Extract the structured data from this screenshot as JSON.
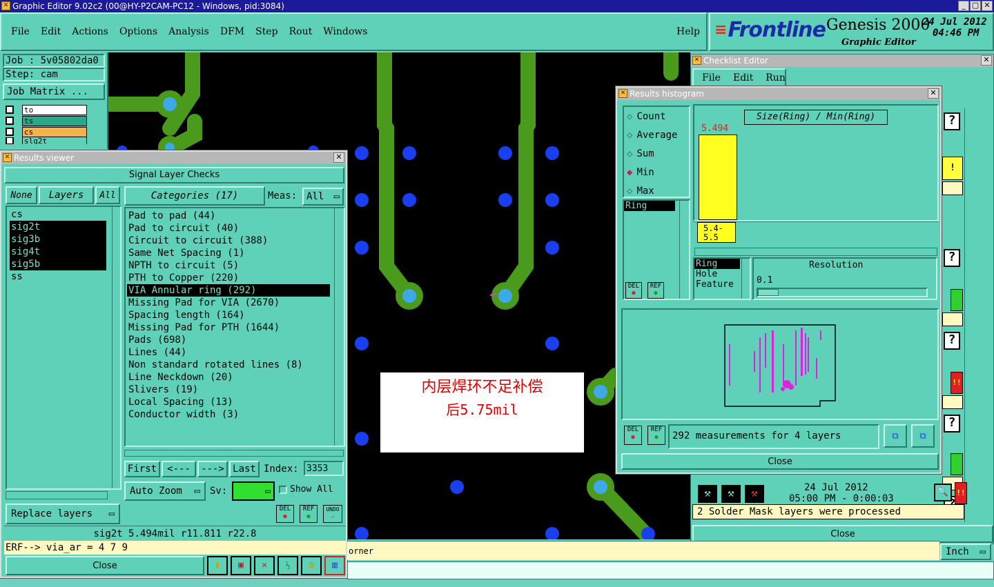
{
  "app": {
    "title": "Graphic Editor 9.02c2 (00@HY-P2CAM-PC12 - Windows, pid:3084)",
    "menu": [
      "File",
      "Edit",
      "Actions",
      "Options",
      "Analysis",
      "DFM",
      "Step",
      "Rout",
      "Windows"
    ],
    "help": "Help",
    "brand": "Frontline",
    "product": "Genesis 2000",
    "subtitle": "Graphic Editor",
    "date": "24 Jul 2012",
    "time": "04:46 PM"
  },
  "job": {
    "job_label": "Job  : 5v05802da0",
    "step_label": "Step: cam",
    "matrix_button": "Job Matrix ...",
    "layers": [
      {
        "name": "to",
        "color": "#ffffff"
      },
      {
        "name": "ts",
        "color": "#2aa88a"
      },
      {
        "name": "cs",
        "color": "#f4b24a"
      },
      {
        "name": "slg2t",
        "color": "#5fd1b8"
      }
    ]
  },
  "results_viewer": {
    "title": "Results viewer",
    "heading": "Signal Layer Checks",
    "none_btn": "None",
    "layers_btn": "Layers",
    "all_btn": "All",
    "layer_list": [
      {
        "name": "cs",
        "selected": false
      },
      {
        "name": "sig2t",
        "selected": true
      },
      {
        "name": "sig3b",
        "selected": true
      },
      {
        "name": "sig4t",
        "selected": true
      },
      {
        "name": "sig5b",
        "selected": true
      },
      {
        "name": "ss",
        "selected": false
      }
    ],
    "categories_btn": "Categories (17)",
    "meas_label": "Meas:",
    "meas_value": "All",
    "categories": [
      {
        "label": "Pad to pad (44)",
        "selected": false
      },
      {
        "label": "Pad to circuit (40)",
        "selected": false
      },
      {
        "label": "Circuit to circuit (388)",
        "selected": false
      },
      {
        "label": "Same Net Spacing (1)",
        "selected": false
      },
      {
        "label": "NPTH to circuit (5)",
        "selected": false
      },
      {
        "label": "PTH to Copper (220)",
        "selected": false
      },
      {
        "label": "VIA Annular ring (292)",
        "selected": true
      },
      {
        "label": "Missing Pad for VIA (2670)",
        "selected": false
      },
      {
        "label": "Spacing length (164)",
        "selected": false
      },
      {
        "label": "Missing Pad for PTH (1644)",
        "selected": false
      },
      {
        "label": "Pads (698)",
        "selected": false
      },
      {
        "label": "Lines (44)",
        "selected": false
      },
      {
        "label": "Non standard rotated lines (8)",
        "selected": false
      },
      {
        "label": "Line Neckdown (20)",
        "selected": false
      },
      {
        "label": "Slivers (19)",
        "selected": false
      },
      {
        "label": "Local Spacing (13)",
        "selected": false
      },
      {
        "label": "Conductor width (3)",
        "selected": false
      }
    ],
    "first": "First",
    "prev": "<---",
    "next": "--->",
    "last": "Last",
    "index_label": "Index:",
    "index_value": "3353",
    "auto_zoom": "Auto Zoom",
    "sv_label": "Sv:",
    "show_all": "Show All",
    "replace_layers": "Replace layers",
    "del": "DEL",
    "ref": "REF",
    "undo": "UNDO",
    "status": "sig2t 5.494mil  r11.811  r22.8",
    "command": "ERF--> via_ar = 4 7 9",
    "close": "Close"
  },
  "annotation": {
    "line1": "内层焊环不足补偿",
    "line2": "后5.75mil"
  },
  "histogram": {
    "title": "Results histogram",
    "modes": [
      {
        "label": "Count",
        "active": false
      },
      {
        "label": "Average",
        "active": false
      },
      {
        "label": "Sum",
        "active": false
      },
      {
        "label": "Min",
        "active": true
      },
      {
        "label": "Max",
        "active": false
      }
    ],
    "chart_title": "Size(Ring) / Min(Ring)",
    "bar_value": "5.494",
    "bar_range": "5.4- 5.5",
    "left_list": [
      "Ring"
    ],
    "attr_list": [
      "Ring",
      "Hole",
      "Feature"
    ],
    "resolution_label": "Resolution",
    "resolution_value": "0.1",
    "summary": "292 measurements for 4 layers",
    "close": "Close",
    "del": "DEL",
    "ref": "REF"
  },
  "checklist": {
    "title": "Checklist Editor",
    "menu": [
      "File",
      "Edit",
      "Run"
    ],
    "date": "24 Jul 2012",
    "time": "05:00 PM - 0:00:03",
    "message": "2 Solder Mask layers were processed",
    "close": "Close",
    "badge_warn": "!",
    "badge_err": "!!"
  },
  "bottom": {
    "status_text": "orner",
    "units": "Inch"
  }
}
